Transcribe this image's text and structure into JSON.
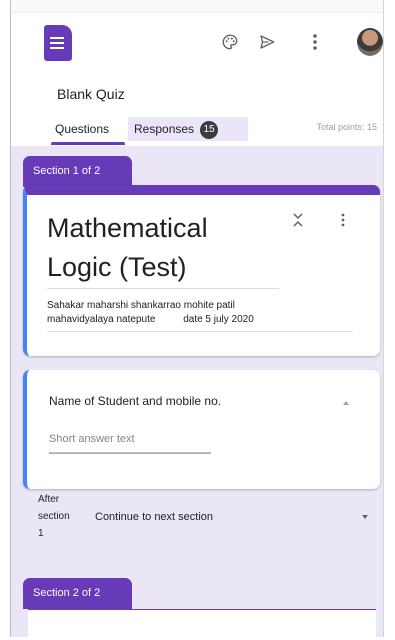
{
  "app": {
    "name": "Google Forms"
  },
  "toolbar": {
    "palette_icon": "palette-icon",
    "send_icon": "send-icon",
    "more_icon": "more-vert-icon",
    "avatar": "user-avatar"
  },
  "document": {
    "title": "Blank Quiz"
  },
  "tabs": {
    "questions": "Questions",
    "responses": "Responses",
    "responses_count": "15",
    "total_points": "Total points: 15"
  },
  "colors": {
    "accent": "#673ab7",
    "accent_light": "#ebe6f5",
    "focus": "#4285f4"
  },
  "section1": {
    "label": "Section 1 of 2",
    "title_line1": "Mathematical",
    "title_line2": "Logic  (Test)",
    "desc_line1": "Sahakar maharshi shankarrao mohite patil",
    "desc_line2": "mahavidyalaya natepute          date 5 july 2020"
  },
  "question1": {
    "title": "Name of Student and mobile no.",
    "placeholder": "Short answer text"
  },
  "after_section": {
    "line1": "After",
    "line2": "section",
    "line3": "1",
    "value": "Continue to next section"
  },
  "section2": {
    "label": "Section 2 of 2"
  }
}
